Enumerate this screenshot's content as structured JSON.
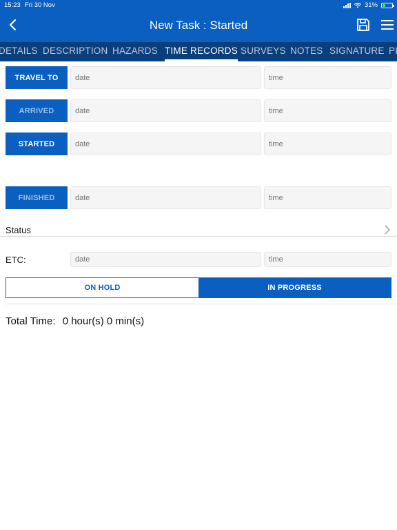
{
  "status_bar": {
    "time": "15:23",
    "date": "Fri 30 Nov",
    "battery": "31%",
    "battery_level": 0.31
  },
  "header": {
    "title": "New Task : Started",
    "back_icon": "chevron-left-icon",
    "save_icon": "floppy-disk-icon",
    "menu_icon": "hamburger-menu-icon"
  },
  "tabs": [
    {
      "label": "DETAILS",
      "active": false
    },
    {
      "label": "DESCRIPTION",
      "active": false
    },
    {
      "label": "HAZARDS",
      "active": false
    },
    {
      "label": "TIME RECORDS",
      "active": true
    },
    {
      "label": "SURVEYS",
      "active": false
    },
    {
      "label": "NOTES",
      "active": false
    },
    {
      "label": "SIGNATURE",
      "active": false
    },
    {
      "label": "PI",
      "active": false
    }
  ],
  "time_records": [
    {
      "label": "TRAVEL TO",
      "enabled": true,
      "date_placeholder": "date",
      "time_placeholder": "time"
    },
    {
      "label": "ARRIVED",
      "enabled": false,
      "date_placeholder": "date",
      "time_placeholder": "time"
    },
    {
      "label": "STARTED",
      "enabled": true,
      "date_placeholder": "date",
      "time_placeholder": "time"
    },
    {
      "label": "FINISHED",
      "enabled": false,
      "date_placeholder": "date",
      "time_placeholder": "time"
    }
  ],
  "status": {
    "label": "Status"
  },
  "etc": {
    "label": "ETC:",
    "date_placeholder": "date",
    "time_placeholder": "time"
  },
  "toggle": {
    "on_hold": "ON HOLD",
    "in_progress": "IN PROGRESS",
    "selected": "in_progress"
  },
  "total": {
    "label": "Total Time:",
    "value": "0 hour(s) 0 min(s)"
  },
  "colors": {
    "primary": "#0a5fc0",
    "tab_bar": "#0a3f7e",
    "battery": "#4cd964"
  }
}
